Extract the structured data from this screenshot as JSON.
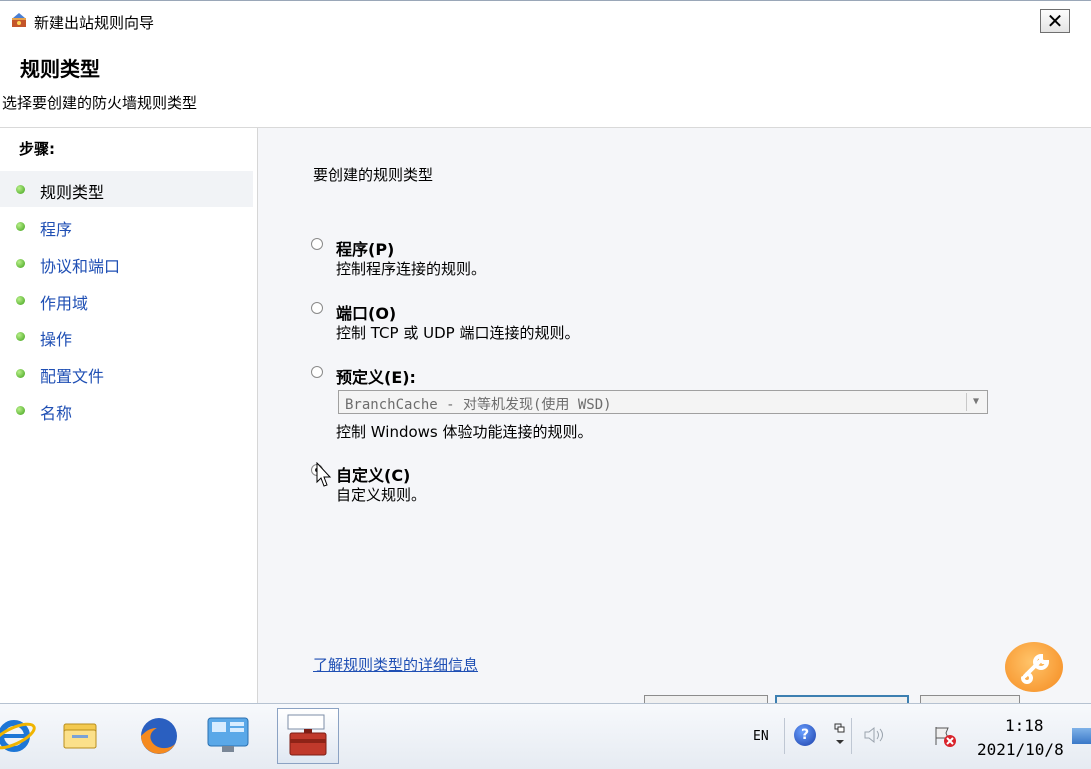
{
  "window": {
    "title": "新建出站规则向导",
    "close_glyph": "✕"
  },
  "header": {
    "title": "规则类型",
    "subtitle": "选择要创建的防火墙规则类型"
  },
  "sidebar": {
    "steps_label": "步骤:",
    "items": [
      {
        "label": "规则类型",
        "active": true
      },
      {
        "label": "程序"
      },
      {
        "label": "协议和端口"
      },
      {
        "label": "作用域"
      },
      {
        "label": "操作"
      },
      {
        "label": "配置文件"
      },
      {
        "label": "名称"
      }
    ]
  },
  "main": {
    "prompt": "要创建的规则类型",
    "options": [
      {
        "title": "程序(P)",
        "desc": "控制程序连接的规则。",
        "selected": false
      },
      {
        "title": "端口(O)",
        "desc": "控制 TCP 或 UDP 端口连接的规则。",
        "selected": false
      },
      {
        "title": "预定义(E):",
        "selected": false
      },
      {
        "title": "自定义(C)",
        "desc": "自定义规则。",
        "selected": true
      }
    ],
    "predefined_select": {
      "value": "BranchCache - 对等机发现(使用 WSD)",
      "desc": "控制 Windows 体验功能连接的规则。"
    },
    "learn_link": "了解规则类型的详细信息"
  },
  "taskbar": {
    "language": "EN",
    "help": "?",
    "time": "1:18",
    "date": "2021/10/8"
  }
}
